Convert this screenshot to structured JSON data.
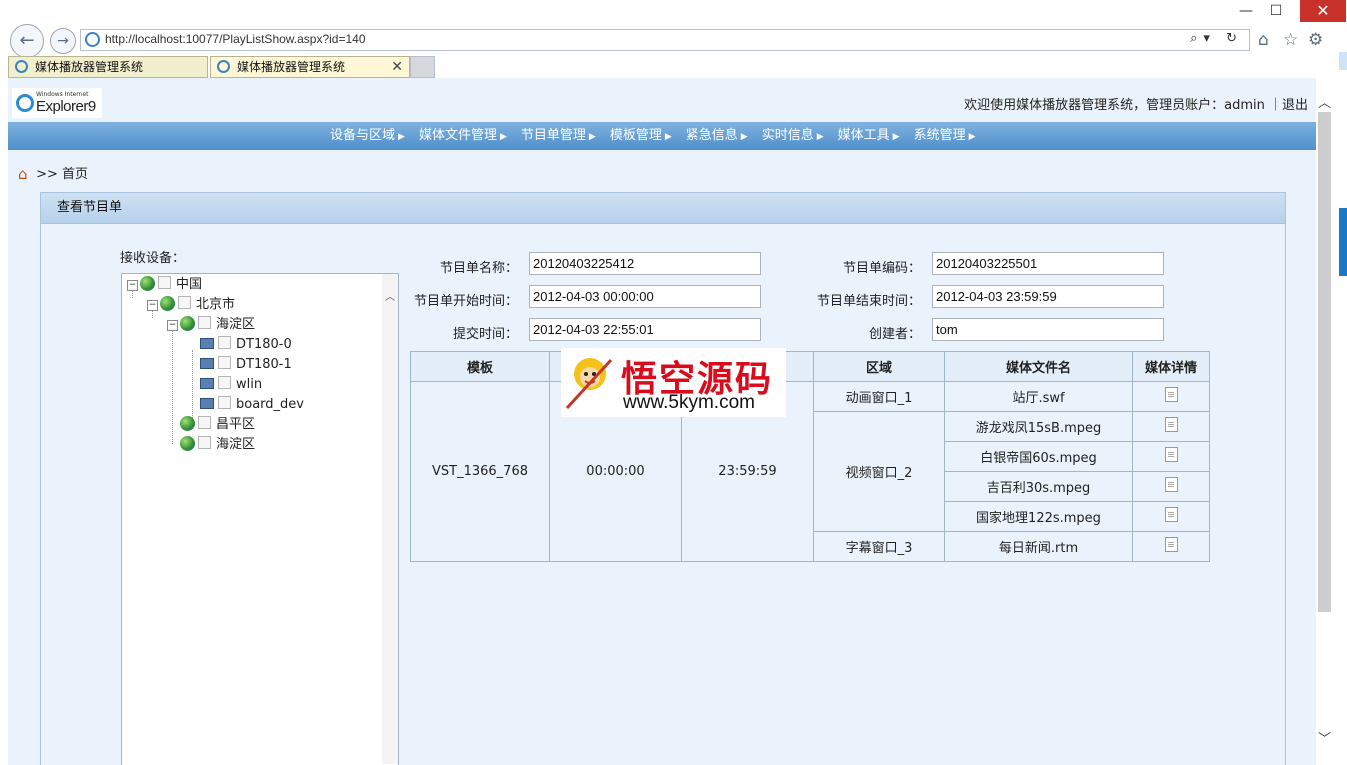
{
  "browser": {
    "url": "http://localhost:10077/PlayListShow.aspx?id=140",
    "tabs": [
      {
        "label": "媒体播放器管理系统"
      },
      {
        "label": "媒体播放器管理系统"
      }
    ],
    "window_controls": {
      "min": "—",
      "max": "☐",
      "close": "✕"
    },
    "address_tools": "⌕▾ ↻"
  },
  "header": {
    "logo_small": "Windows Internet",
    "logo_text": "Explorer9",
    "welcome": "欢迎使用媒体播放器管理系统，管理员账户：admin ｜退出"
  },
  "menu": [
    {
      "label": "设备与区域"
    },
    {
      "label": "媒体文件管理"
    },
    {
      "label": "节目单管理"
    },
    {
      "label": "模板管理"
    },
    {
      "label": "紧急信息"
    },
    {
      "label": "实时信息"
    },
    {
      "label": "媒体工具"
    },
    {
      "label": "系统管理"
    }
  ],
  "breadcrumb": ">> 首页",
  "panel": {
    "title": "查看节目单",
    "receiver_label": "接收设备："
  },
  "tree": {
    "root": "中国",
    "city": "北京市",
    "district": "海淀区",
    "devices": [
      "DT180-0",
      "DT180-1",
      "wlin",
      "board_dev"
    ],
    "other_districts": [
      "昌平区",
      "海淀区"
    ]
  },
  "form": {
    "name_label": "节目单名称：",
    "name_value": "20120403225412",
    "code_label": "节目单编码：",
    "code_value": "20120403225501",
    "start_label": "节目单开始时间：",
    "start_value": "2012-04-03 00:00:00",
    "end_label": "节目单结束时间：",
    "end_value": "2012-04-03 23:59:59",
    "submit_label": "提交时间：",
    "submit_value": "2012-04-03 22:55:01",
    "creator_label": "创建者：",
    "creator_value": "tom"
  },
  "table": {
    "headers": [
      "模板",
      "",
      "",
      "区域",
      "媒体文件名",
      "媒体详情"
    ],
    "template": "VST_1366_768",
    "start": "00:00:00",
    "end": "23:59:59",
    "rows": [
      {
        "region": "动画窗口_1",
        "file": "站厅.swf"
      },
      {
        "region": "视频窗口_2",
        "file": "游龙戏凤15sB.mpeg"
      },
      {
        "region": "",
        "file": "白银帝国60s.mpeg"
      },
      {
        "region": "",
        "file": "吉百利30s.mpeg"
      },
      {
        "region": "",
        "file": "国家地理122s.mpeg"
      },
      {
        "region": "字幕窗口_3",
        "file": "每日新闻.rtm"
      }
    ]
  },
  "watermark": {
    "title": "悟空源码",
    "url": "www.5kym.com"
  }
}
